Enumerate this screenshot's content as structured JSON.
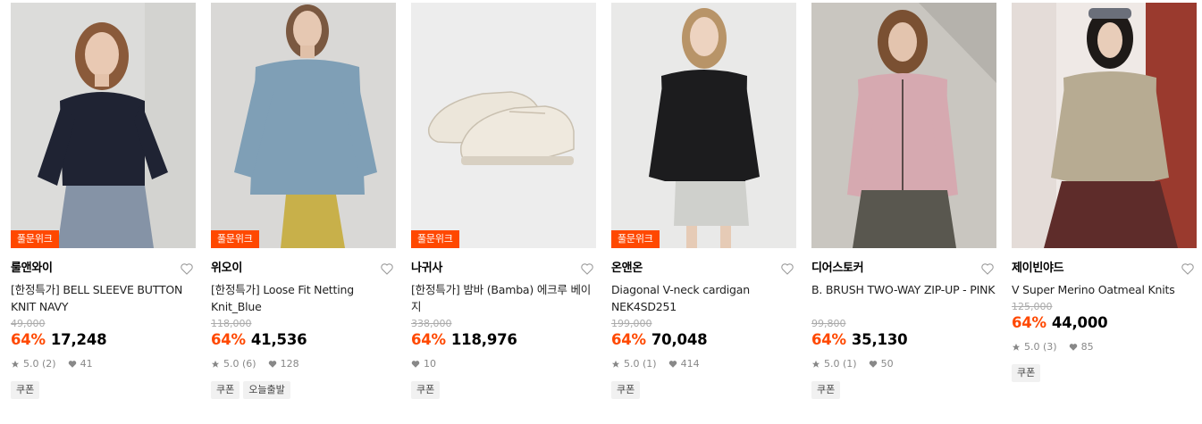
{
  "products": [
    {
      "badge": "풀문위크",
      "brand": "룰앤와이",
      "name": "[한정특가] BELL SLEEVE BUTTON KNIT NAVY",
      "original_price": "49,000",
      "discount": "64%",
      "price": "17,248",
      "rating": "5.0 (2)",
      "likes": "41",
      "tags": [
        "쿠폰"
      ],
      "icon": "heart-icon"
    },
    {
      "badge": "풀문위크",
      "brand": "위오이",
      "name": "[한정특가] Loose Fit Netting Knit_Blue",
      "original_price": "118,000",
      "discount": "64%",
      "price": "41,536",
      "rating": "5.0 (6)",
      "likes": "128",
      "tags": [
        "쿠폰",
        "오늘출발"
      ],
      "icon": "heart-icon"
    },
    {
      "badge": "풀문위크",
      "brand": "나귀사",
      "name": "[한정특가] 밤바 (Bamba) 에크루 베이지",
      "original_price": "338,000",
      "discount": "64%",
      "price": "118,976",
      "rating": "",
      "likes": "10",
      "tags": [
        "쿠폰"
      ],
      "icon": "heart-icon"
    },
    {
      "badge": "풀문위크",
      "brand": "온앤온",
      "name": "Diagonal V-neck cardigan NEK4SD251",
      "original_price": "199,000",
      "discount": "64%",
      "price": "70,048",
      "rating": "5.0 (1)",
      "likes": "414",
      "tags": [
        "쿠폰"
      ],
      "icon": "heart-icon"
    },
    {
      "badge": "",
      "brand": "디어스토커",
      "name": "B. BRUSH TWO-WAY ZIP-UP - PINK",
      "original_price": "99,800",
      "discount": "64%",
      "price": "35,130",
      "rating": "5.0 (1)",
      "likes": "50",
      "tags": [
        "쿠폰"
      ],
      "icon": "heart-icon"
    },
    {
      "badge": "",
      "brand": "제이빈야드",
      "name": "V Super Merino Oatmeal Knits",
      "original_price": "125,000",
      "discount": "64%",
      "price": "44,000",
      "rating": "5.0 (3)",
      "likes": "85",
      "tags": [
        "쿠폰"
      ],
      "icon": "heart-icon"
    }
  ],
  "colors": {
    "accent": "#ff4800",
    "muted": "#888888",
    "strike": "#aaaaaa",
    "tag_bg": "#f1f1f1"
  }
}
